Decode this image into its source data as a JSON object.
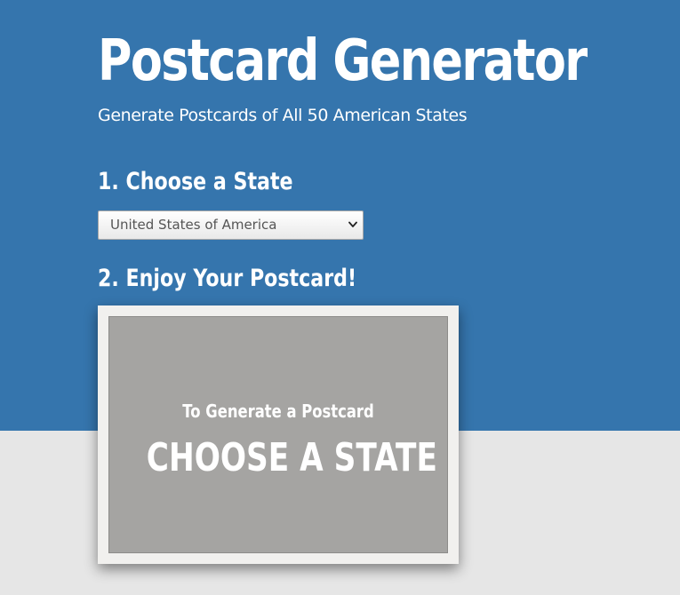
{
  "header": {
    "title": "Postcard Generator",
    "subtitle": "Generate Postcards of All 50 American States"
  },
  "steps": {
    "choose_state": "1. Choose a State",
    "enjoy_postcard": "2. Enjoy Your Postcard!"
  },
  "state_select": {
    "selected_value": "United States of America"
  },
  "postcard": {
    "caption": "To Generate a Postcard",
    "headline": "CHOOSE A STATE"
  },
  "colors": {
    "header_background": "#3575ad",
    "page_background": "#e6e6e6",
    "postcard_background": "#a5a4a2",
    "text_on_dark": "#ffffff"
  },
  "icons": {
    "select_arrow": "chevron-down-icon"
  }
}
